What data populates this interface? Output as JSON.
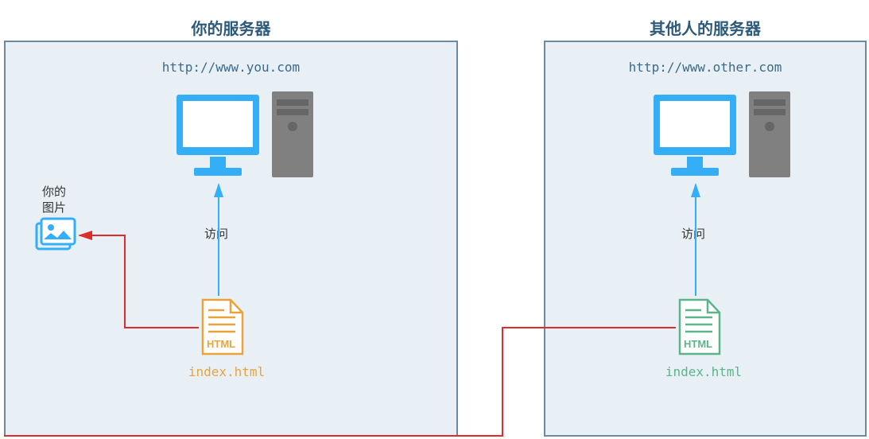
{
  "left": {
    "title": "你的服务器",
    "url": "http://www.you.com",
    "image_label": "你的\n图片",
    "access_label": "访问",
    "file_label": "index.html"
  },
  "right": {
    "title": "其他人的服务器",
    "url": "http://www.other.com",
    "access_label": "访问",
    "file_label": "index.html"
  }
}
